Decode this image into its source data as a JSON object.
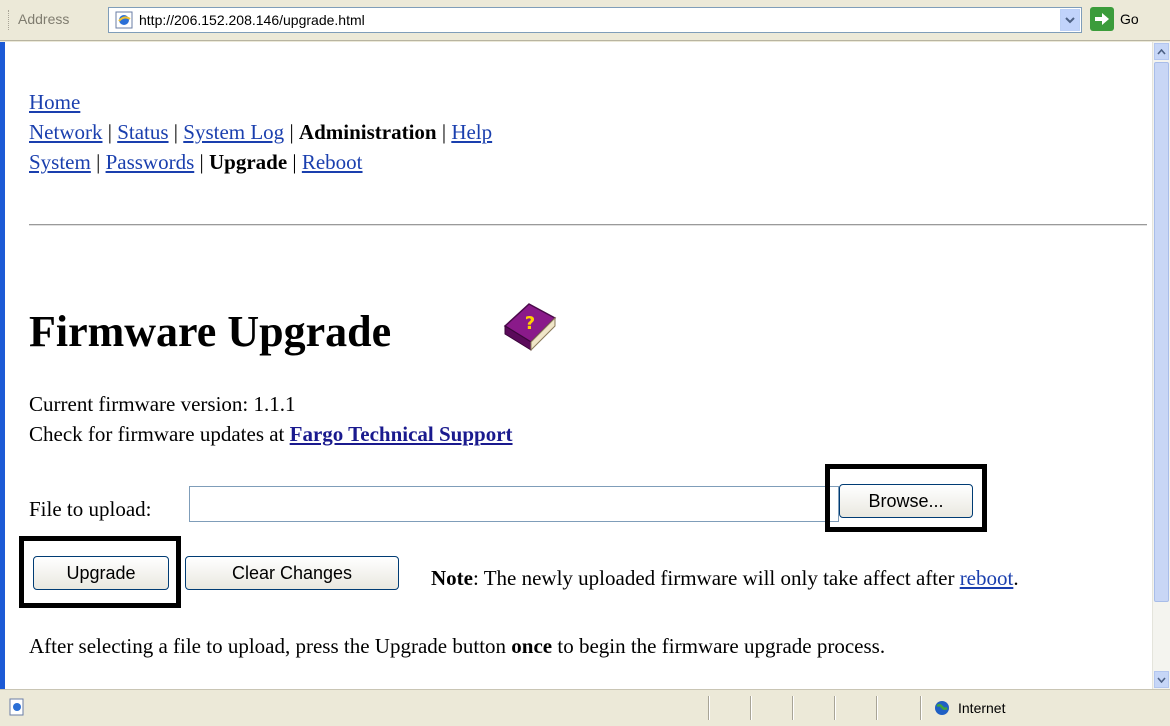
{
  "address_bar": {
    "label": "Address",
    "url": "http://206.152.208.146/upgrade.html",
    "go_label": "Go"
  },
  "nav": {
    "home": "Home",
    "row2": {
      "network": "Network",
      "status": "Status",
      "system_log": "System Log",
      "administration": "Administration",
      "help": "Help",
      "sep": "|"
    },
    "row3": {
      "system": "System",
      "passwords": "Passwords",
      "upgrade": "Upgrade",
      "reboot": "Reboot"
    }
  },
  "page": {
    "title": "Firmware Upgrade",
    "current_version_text": "Current firmware version: 1.1.1",
    "check_text": "Check for firmware updates at",
    "support_link": "Fargo Technical Support",
    "file_label": "File to upload:",
    "file_value": "",
    "browse_label": "Browse...",
    "upgrade_label": "Upgrade",
    "clear_label": "Clear Changes",
    "note_bold": "Note",
    "note_text": ": The newly uploaded firmware will only take affect after",
    "note_link": "reboot",
    "note_end": ".",
    "after_prefix": "After selecting a file to upload, press the Upgrade button",
    "after_bold": "once",
    "after_suffix": "to begin the firmware upgrade process."
  },
  "status_bar": {
    "zone": "Internet"
  },
  "colors": {
    "link": "#1a3fae",
    "window_border": "#1c5ad6",
    "go_button": "#3b9c3b"
  }
}
